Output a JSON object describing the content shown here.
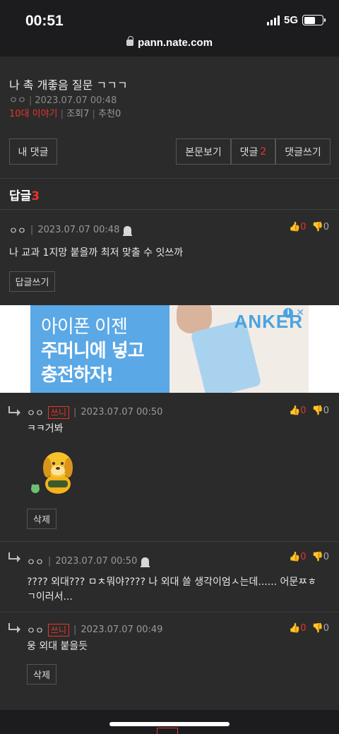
{
  "status_bar": {
    "time": "00:51",
    "network": "5G"
  },
  "browser": {
    "url": "pann.nate.com"
  },
  "post": {
    "title": "나 촉 개좋음 질문 ㄱㄱㄱ",
    "author": "ㅇㅇ",
    "date": "2023.07.07 00:48",
    "category": "10대 이야기",
    "views_label": "조회",
    "views": "7",
    "recommend_label": "추천",
    "recommend": "0"
  },
  "buttons": {
    "my_comments": "내 댓글",
    "view_post": "본문보기",
    "comments": "댓글",
    "comments_count": "2",
    "write_comment": "댓글쓰기"
  },
  "replies_header": {
    "label": "답글",
    "count": "3"
  },
  "comments": [
    {
      "nick": "ㅇㅇ",
      "date": "2023.07.07 00:48",
      "text": "나 교과 1지망 붙을까 최저 맞출 수 잇쓰까",
      "up": "0",
      "down": "0",
      "action": "답글쓰기"
    },
    {
      "nick": "ㅇㅇ",
      "badge": "쓰니",
      "date": "2023.07.07 00:50",
      "text": "ㅋㅋ거봐",
      "up": "0",
      "down": "0",
      "action": "삭제"
    },
    {
      "nick": "ㅇㅇ",
      "date": "2023.07.07 00:50",
      "text": "???? 외대??? ㅁㅊ뭐야???? 나 외대 쓸 생각이엄ㅅ는데...... 어문ㅉㅎㄱ이러서...",
      "up": "0",
      "down": "0"
    },
    {
      "nick": "ㅇㅇ",
      "badge": "쓰니",
      "date": "2023.07.07 00:49",
      "text": "웅 외대 붙을듯",
      "up": "0",
      "down": "0",
      "action": "삭제"
    }
  ],
  "ad": {
    "line1": "아이폰 이젠",
    "line2": "주머니에 넣고",
    "line3": "충전하자!",
    "brand": "ANKER"
  },
  "colors": {
    "accent": "#e8352a",
    "background": "#2b2b2b"
  }
}
